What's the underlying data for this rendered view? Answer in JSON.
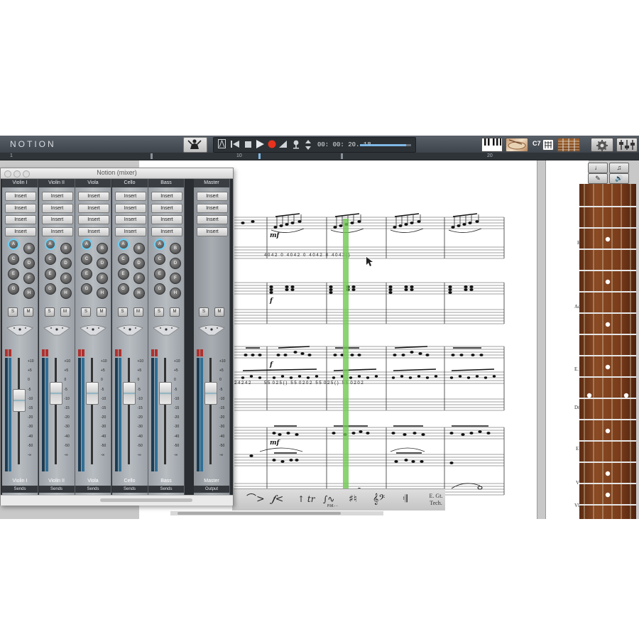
{
  "app": {
    "logo": "NOTION"
  },
  "transport": {
    "time": "00: 00: 20. 18",
    "volume_fraction": 0.9,
    "buttons": [
      "metronome-icon",
      "rewind-icon",
      "stop-icon",
      "play-icon",
      "record-icon",
      "ramp-icon",
      "mic-icon",
      "up-down-icon"
    ]
  },
  "toolbar_right": {
    "key_label": "C7"
  },
  "ruler": {
    "marks": [
      "1",
      "10",
      "20"
    ]
  },
  "mixer": {
    "title": "Notion (mixer)",
    "insert_label": "Insert",
    "send_labels": [
      "A",
      "B",
      "C",
      "D",
      "E",
      "F",
      "G",
      "H"
    ],
    "solo_label": "S",
    "mute_label": "M",
    "scale": [
      "+10",
      "+5",
      "0",
      "-5",
      "-10",
      "-15",
      "-20",
      "-30",
      "-40",
      "-50",
      "-∞"
    ],
    "channels": [
      {
        "name": "Violin I",
        "footer": "Sends",
        "fader_level": 0.72
      },
      {
        "name": "Violin II",
        "footer": "Sends",
        "fader_level": 0.8
      },
      {
        "name": "Viola",
        "footer": "Sends",
        "fader_level": 0.8
      },
      {
        "name": "Cello",
        "footer": "Sends",
        "fader_level": 0.8
      },
      {
        "name": "Bass",
        "footer": "Sends",
        "fader_level": 0.8
      }
    ],
    "master": {
      "name": "Master",
      "footer": "Output",
      "fader_level": 0.8
    }
  },
  "score": {
    "dynamics": [
      "mf",
      "f",
      "f",
      "mf"
    ],
    "tab_rows": [
      "4 0 4 2   0   4 0 4 2   0   4 0 4 2   0   4 0 4 2 ( )",
      "5 5  0 2 5 ( )   5 5  0 2 0 2   5 5  0 2 5 ( )   5 5  0 2 0 2",
      "2 4 2 4 2"
    ],
    "side_labels": [
      "E.",
      "Ac",
      "E.",
      "Dr",
      "E.",
      "V",
      "Vl"
    ]
  },
  "palette": {
    "tech_label_1": "E. Gt.",
    "tech_label_2": "Tech.",
    "pm_label": "P.M.- -"
  },
  "colors": {
    "playhead": "#6ec850",
    "record": "#e8321e",
    "accent": "#6ad0f5"
  }
}
